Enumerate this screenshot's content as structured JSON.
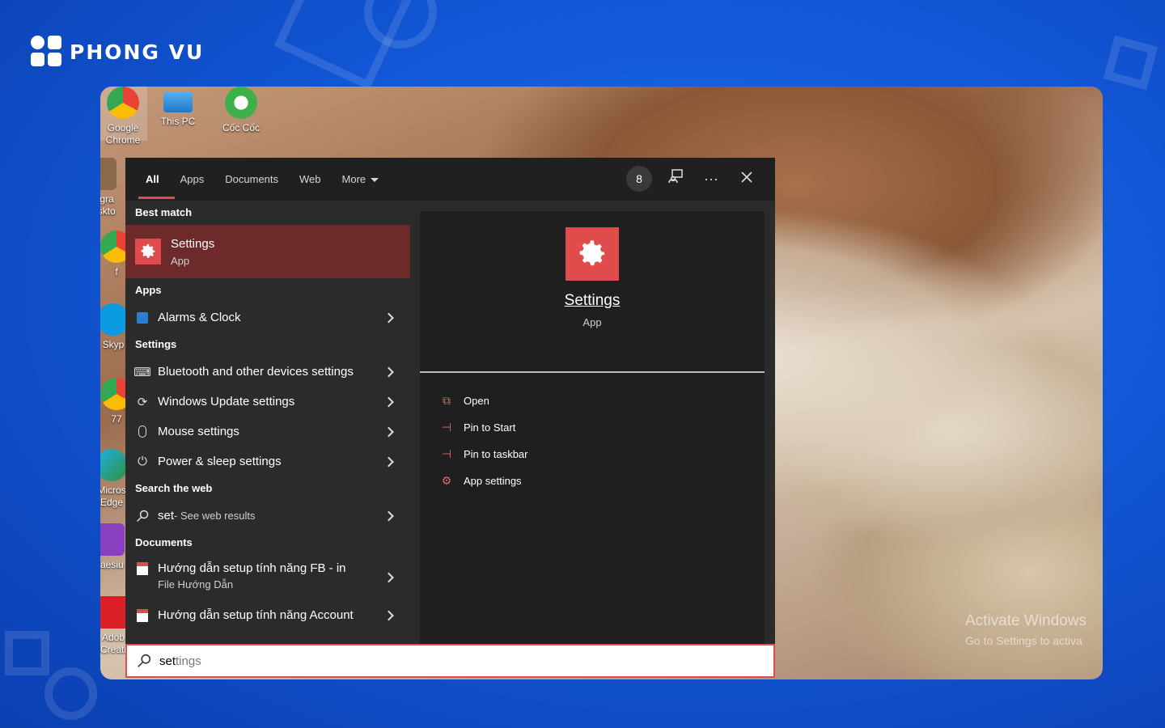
{
  "brand": {
    "name": "PHONG VU"
  },
  "desktop": {
    "icons": [
      {
        "label": "Google Chrome"
      },
      {
        "label": "This PC"
      },
      {
        "label": "Cốc Cốc"
      },
      {
        "label": "elegra Deskto"
      },
      {
        "label": "f"
      },
      {
        "label": "Skyp"
      },
      {
        "label": "77"
      },
      {
        "label": "Micros Edge"
      },
      {
        "label": "Caesiu"
      },
      {
        "label": "Adob Creati"
      }
    ],
    "watermark_title": "Activate Windows",
    "watermark_sub": "Go to Settings to activa"
  },
  "search_panel": {
    "tabs": [
      "All",
      "Apps",
      "Documents",
      "Web",
      "More"
    ],
    "active_tab": "All",
    "badge_count": "8",
    "best_match_header": "Best match",
    "best_match": {
      "title": "Settings",
      "subtitle": "App"
    },
    "apps_header": "Apps",
    "apps": [
      {
        "label": "Alarms & Clock"
      }
    ],
    "settings_header": "Settings",
    "settings_items": [
      {
        "label": "Bluetooth and other devices settings"
      },
      {
        "label": "Windows Update settings"
      },
      {
        "label": "Mouse settings"
      },
      {
        "label": "Power & sleep settings"
      }
    ],
    "web_header": "Search the web",
    "web_item": {
      "query": "set",
      "suffix": " - See web results"
    },
    "documents_header": "Documents",
    "documents": [
      {
        "label": "Hướng dẫn setup tính năng FB - in",
        "sub": "File Hướng Dẫn"
      },
      {
        "label": "Hướng dẫn setup tính năng Account"
      }
    ],
    "preview": {
      "title": "Settings",
      "subtitle": "App",
      "actions": [
        "Open",
        "Pin to Start",
        "Pin to taskbar",
        "App settings"
      ]
    },
    "search_box": {
      "typed": "set",
      "completion": "tings"
    }
  },
  "colors": {
    "accent": "#e04b4b",
    "selected": "#6e2a2a",
    "panel": "#2b2b2b",
    "background": "#1258d8"
  }
}
